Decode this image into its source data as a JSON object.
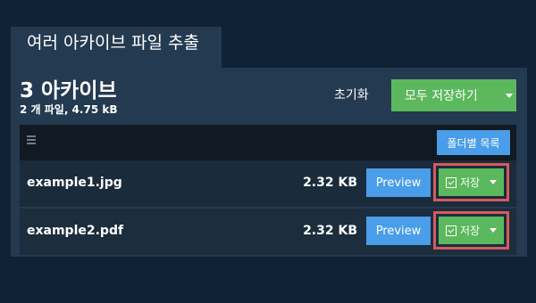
{
  "tab": {
    "title": "여러 아카이브 파일 추출"
  },
  "summary": {
    "archive_count": "3 아카이브",
    "meta": "2 개 파일, 4.75 kB"
  },
  "actions": {
    "reset_label": "초기화",
    "save_all_label": "모두 저장하기"
  },
  "list": {
    "folder_list_label": "폴더별 목록",
    "files": [
      {
        "name": "example1.jpg",
        "size": "2.32 KB",
        "preview_label": "Preview",
        "save_label": "저장"
      },
      {
        "name": "example2.pdf",
        "size": "2.32 KB",
        "preview_label": "Preview",
        "save_label": "저장"
      }
    ]
  },
  "colors": {
    "background": "#0f2236",
    "panel": "#243a50",
    "primary_blue": "#4a9de8",
    "save_green": "#5cb85c",
    "highlight_red": "#d65a5a"
  },
  "icons": {
    "menu": "hamburger-menu-icon",
    "download": "download-icon",
    "caret": "caret-down-icon"
  }
}
